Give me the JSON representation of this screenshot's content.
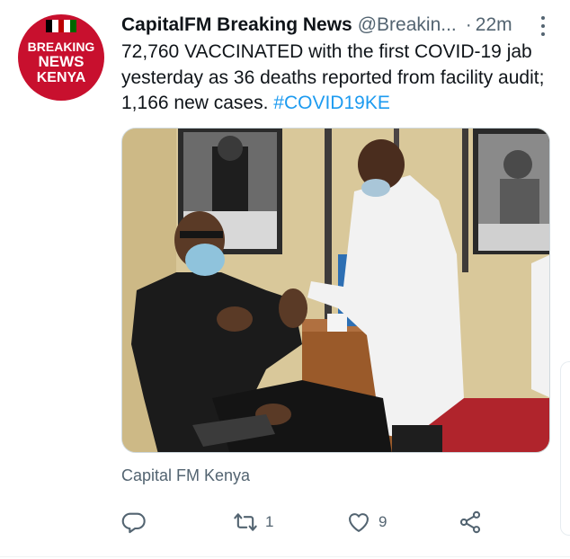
{
  "avatar": {
    "line1": "BREAKING",
    "line2": "NEWS",
    "line3": "KENYA"
  },
  "header": {
    "display_name": "CapitalFM Breaking News",
    "handle": "@Breakin...",
    "separator": "·",
    "time": "22m"
  },
  "tweet": {
    "text": "72,760 VACCINATED with the first COVID-19 jab yesterday as 36 deaths reported from facility audit; 1,166 new cases.",
    "hashtag": "#COVID19KE"
  },
  "source": "Capital FM Kenya",
  "actions": {
    "reply_count": "",
    "retweet_count": "1",
    "like_count": "9"
  },
  "colors": {
    "accent": "#1d9bf0",
    "muted": "#536471",
    "avatar_red": "#c8102e"
  },
  "icons": [
    "more-icon",
    "reply-icon",
    "retweet-icon",
    "like-icon",
    "share-icon"
  ]
}
